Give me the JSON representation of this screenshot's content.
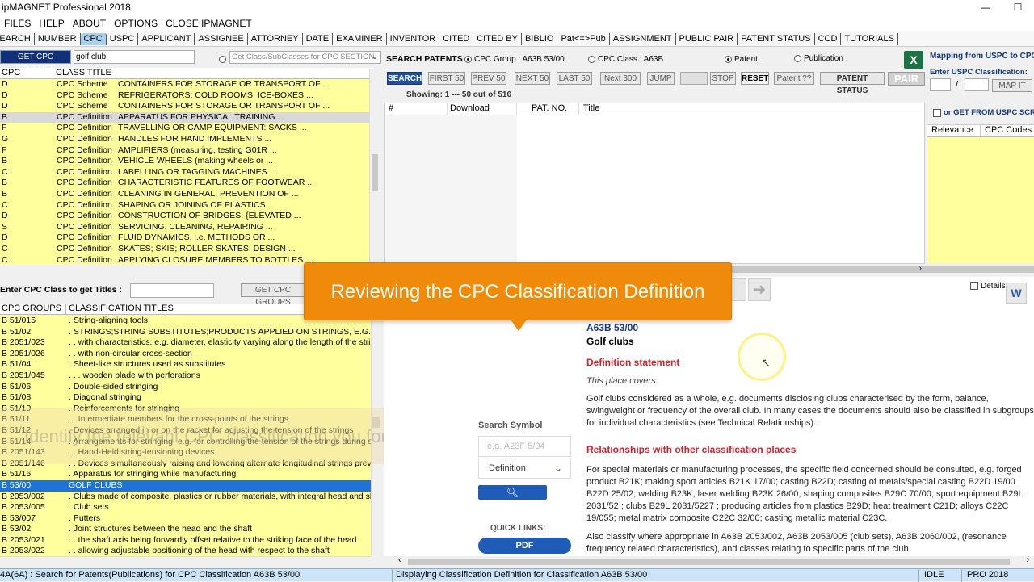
{
  "window": {
    "title": "ipMAGNET Professional 2018",
    "min": "—",
    "max": "☐"
  },
  "menu": [
    "FILES",
    "HELP",
    "ABOUT",
    "OPTIONS",
    "CLOSE IPMAGNET"
  ],
  "tabs": [
    "SEARCH",
    "NUMBER",
    "CPC",
    "USPC",
    "APPLICANT",
    "ASSIGNEE",
    "ATTORNEY",
    "DATE",
    "EXAMINER",
    "INVENTOR",
    "CITED",
    "CITED BY",
    "BIBLIO",
    "Pat<=>Pub",
    "ASSIGNMENT",
    "PUBLIC PAIR",
    "PATENT STATUS",
    "CCD",
    "TUTORIALS"
  ],
  "active_tab": "CPC",
  "cpc_search": {
    "button": "GET CPC SCHEMES",
    "query": "golf club",
    "section_placeholder": "Get Class/SubClasses for CPC SECTION",
    "col_classes": "CPC CLASSES",
    "col_title": "CLASS TITLE",
    "rows": [
      {
        "cls": "D",
        "type": "CPC Scheme",
        "title": "CONTAINERS FOR STORAGE OR TRANSPORT OF ..."
      },
      {
        "cls": "D",
        "type": "CPC Scheme",
        "title": "REFRIGERATORS; COLD ROOMS; ICE-BOXES ..."
      },
      {
        "cls": "D",
        "type": "CPC Scheme",
        "title": "CONTAINERS FOR STORAGE OR TRANSPORT OF ..."
      },
      {
        "cls": "B",
        "type": "CPC Definition",
        "title": "APPARATUS FOR PHYSICAL TRAINING ..."
      },
      {
        "cls": "F",
        "type": "CPC Definition",
        "title": "TRAVELLING OR CAMP EQUIPMENT: SACKS ..."
      },
      {
        "cls": "G",
        "type": "CPC Definition",
        "title": "HANDLES FOR HAND IMPLEMENTS ..."
      },
      {
        "cls": "F",
        "type": "CPC Definition",
        "title": "AMPLIFIERS (measuring, testing G01R ..."
      },
      {
        "cls": "B",
        "type": "CPC Definition",
        "title": "VEHICLE WHEELS (making wheels or ..."
      },
      {
        "cls": "C",
        "type": "CPC Definition",
        "title": "LABELLING OR TAGGING MACHINES ..."
      },
      {
        "cls": "B",
        "type": "CPC Definition",
        "title": "CHARACTERISTIC FEATURES OF FOOTWEAR ..."
      },
      {
        "cls": "B",
        "type": "CPC Definition",
        "title": "CLEANING IN GENERAL; PREVENTION OF ..."
      },
      {
        "cls": "C",
        "type": "CPC Definition",
        "title": "SHAPING OR JOINING OF PLASTICS ..."
      },
      {
        "cls": "D",
        "type": "CPC Definition",
        "title": "CONSTRUCTION OF BRIDGES, {ELEVATED ..."
      },
      {
        "cls": "S",
        "type": "CPC Definition",
        "title": "SERVICING, CLEANING, REPAIRING ..."
      },
      {
        "cls": "D",
        "type": "CPC Definition",
        "title": "FLUID DYNAMICS, i.e. METHODS OR ..."
      },
      {
        "cls": "C",
        "type": "CPC Definition",
        "title": "SKATES; SKIS; ROLLER SKATES; DESIGN ..."
      },
      {
        "cls": "C",
        "type": "CPC Definition",
        "title": "APPLYING CLOSURE MEMBERS TO BOTTLES ..."
      }
    ]
  },
  "titles": {
    "label": "Enter CPC Class to get Titles :",
    "button": "GET CPC GROUPS",
    "col_groups": "CPC GROUPS",
    "col_titles": "CLASSIFICATION TITLES",
    "rows": [
      {
        "g": "B  51/015",
        "t": ". String-aligning tools"
      },
      {
        "g": "B  51/02",
        "t": ". STRINGS;STRING SUBSTITUTES;PRODUCTS APPLIED ON STRINGS, E.G. FOR PROTE"
      },
      {
        "g": "B  2051/023",
        "t": ". . with characteristics, e.g. diameter, elasticity varying along the length of the string"
      },
      {
        "g": "B  2051/026",
        "t": ". . with non-circular cross-section"
      },
      {
        "g": "B  51/04",
        "t": ". Sheet-like structures used as substitutes"
      },
      {
        "g": "B  2051/045",
        "t": ". . . wooden blade with perforations"
      },
      {
        "g": "B  51/06",
        "t": ". Double-sided stringing"
      },
      {
        "g": "B  51/08",
        "t": ". Diagonal stringing"
      },
      {
        "g": "B  51/10",
        "t": ". Reinforcements for stringing"
      },
      {
        "g": "B  51/11",
        "t": ". . Intermediate members for the cross-points of the strings"
      },
      {
        "g": "B  51/12",
        "t": ". Devices arranged in or on the racket for adjusting the tension of the strings"
      },
      {
        "g": "B  51/14",
        "t": ". Arrangements for stringing, e.g. for controlling the tension of the strings during st"
      },
      {
        "g": "B  2051/143",
        "t": ". . Hand-Held string-tensioning devices"
      },
      {
        "g": "B  2051/146",
        "t": ". . Devices simultaneously raising and lowering alternate longitudinal strings previo"
      },
      {
        "g": "B  51/16",
        "t": ". Apparatus for stringing while manufacturing"
      },
      {
        "g": "B  53/00",
        "t": "GOLF CLUBS"
      },
      {
        "g": "B  2053/002",
        "t": ". Clubs made of composite, plastics or rubber materials, with integral head and shaf"
      },
      {
        "g": "B  2053/005",
        "t": ". Club sets"
      },
      {
        "g": "B  53/007",
        "t": ". Putters"
      },
      {
        "g": "B  53/02",
        "t": ". Joint structures between the head and the shaft"
      },
      {
        "g": "B  2053/021",
        "t": ". . the shaft axis being forwardly offset relative to the striking face of the head"
      },
      {
        "g": "B  2053/022",
        "t": ". . allowing adjustable positioning of the head with respect to the shaft"
      }
    ],
    "selected_index": 15
  },
  "overlay_caption": "Identify the relevant CPC classification you found by",
  "patents": {
    "header": "SEARCH PATENTS",
    "radio_group": "CPC Group : A63B 53/00",
    "radio_class": "CPC Class :  A63B",
    "radio_patent": "Patent",
    "radio_pub": "Publication",
    "btn_search": "SEARCH",
    "btn_first": "FIRST 50",
    "btn_prev": "PREV 50",
    "btn_next": "NEXT 50",
    "btn_last": "LAST 50",
    "btn_next300": "Next 300",
    "btn_jump": "JUMP",
    "btn_stop": "STOP",
    "btn_reset": "RESET",
    "btn_patentq": "Patent ??",
    "btn_status": "PATENT STATUS",
    "btn_pair": "PAIR",
    "showing": "Showing: 1 --- 50 out of 516",
    "col_num": "#",
    "col_download": "Download",
    "col_patno": "PAT. NO.",
    "col_title": "Title"
  },
  "mapping": {
    "title": "Mapping from USPC to CPC",
    "enter_label": "Enter USPC Classification:",
    "slash": "/",
    "map_button": "MAP IT",
    "alt_label": "or GET FROM USPC SCREEN",
    "col_relevance": "Relevance",
    "col_codes": "CPC Codes"
  },
  "details_label": "Details",
  "callout": "Reviewing the CPC Classification Definition",
  "side": {
    "search_symbol": "Search Symbol",
    "symbol_placeholder": "e.g. A23F 5/04",
    "type_value": "Definition",
    "quick_links": "QUICK LINKS:",
    "pdf": "PDF"
  },
  "definition": {
    "code": "A63B 53/00",
    "name": "Golf clubs",
    "h_statement": "Definition statement",
    "place_covers": "This place covers:",
    "statement": "Golf clubs considered as a whole, e.g. documents disclosing clubs characterised by the form, balance, swingweight or frequency of the overall club. In many cases the documents should also be classified in subgroups for individual characteristics (see Technical Relationships).",
    "h_relationships": "Relationships with other classification places",
    "relationships": "For special materials or manufacturing processes, the specific field concerned should be consulted, e.g. forged product B21K; making sport articles B21K 17/00; casting B22D; casting of metals/special casting B22D 19/00 B22D 25/02; welding B23K; laser welding B23K 26/00; shaping composites B29C 70/00; sport equipment B29L 2031/52 ; clubs B29L 2031/5227 ; producing articles from plastics B29D; heat treatment C21D; alloys C22C 19/055; metal matrix composite C22C 32/00; casting metallic material C23C.",
    "also": "Also classify where appropriate in A63B 2053/002, A63B 2053/005 (club sets), A63B 2060/002, (resonance frequency related characteristics), and classes relating to specific parts of the club."
  },
  "status": {
    "left": "4A(6A) : Search for Patents(Publications) for CPC Classification A63B 53/00",
    "middle": "Displaying Classification Definition for Classification A63B 53/00",
    "idle": "IDLE",
    "version": "PRO 2018"
  }
}
